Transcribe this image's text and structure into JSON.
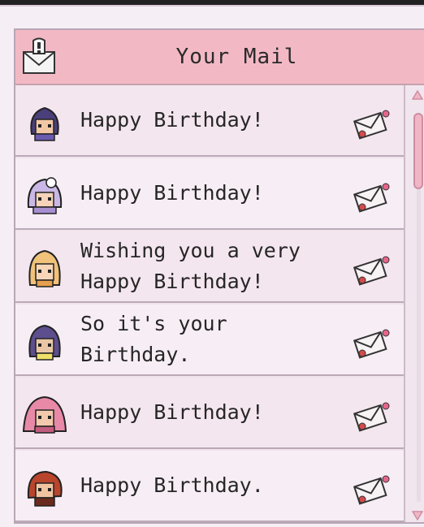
{
  "header": {
    "title": "Your Mail",
    "icon": "mail-alert-icon"
  },
  "messages": [
    {
      "text": "Happy Birthday!",
      "avatar": "purple-hair-character",
      "hair": "#4a3f7a",
      "skin": "#f2c7a5",
      "accent": "#6b5bb0"
    },
    {
      "text": "Happy Birthday!",
      "avatar": "lavender-hair-character",
      "hair": "#c9b8e6",
      "skin": "#f6d3b9",
      "accent": "#a78fd1"
    },
    {
      "text": "Wishing you a very Happy Birthday!",
      "avatar": "blonde-hair-character",
      "hair": "#f0c27a",
      "skin": "#f7d5b6",
      "accent": "#e6a04e"
    },
    {
      "text": "So it's your Birthday.",
      "avatar": "violet-hair-character",
      "hair": "#5d4e8e",
      "skin": "#e9c6a6",
      "accent": "#efe06a"
    },
    {
      "text": "Happy Birthday!",
      "avatar": "pink-hair-character",
      "hair": "#e889a8",
      "skin": "#f3c9ad",
      "accent": "#c25b7d"
    },
    {
      "text": "Happy Birthday.",
      "avatar": "red-hair-character",
      "hair": "#b8452c",
      "skin": "#f0c4a0",
      "accent": "#6a2a1d"
    }
  ],
  "colors": {
    "header": "#f2b9c5",
    "row_alt": "#f4e6ef",
    "scroll_thumb": "#f0b6c5"
  }
}
